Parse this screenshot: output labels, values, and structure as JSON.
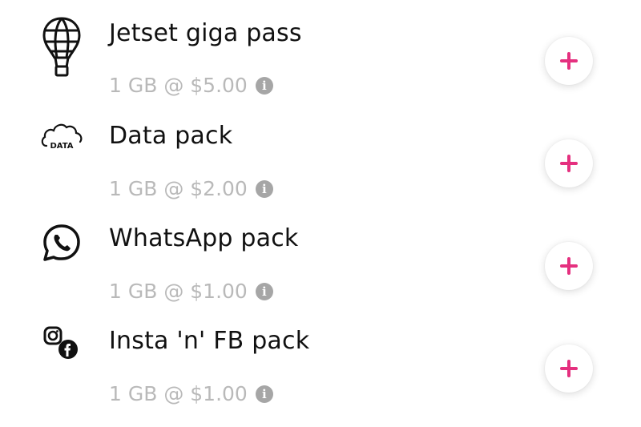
{
  "accent_color": "#e5307f",
  "packs": [
    {
      "title": "Jetset giga pass",
      "price": "1 GB @ $5.00",
      "icon": "hot-air-balloon-icon"
    },
    {
      "title": "Data pack",
      "price": "1 GB @ $2.00",
      "icon": "data-cloud-icon",
      "icon_text": "DATA"
    },
    {
      "title": "WhatsApp pack",
      "price": "1 GB @ $1.00",
      "icon": "whatsapp-icon"
    },
    {
      "title": "Insta 'n' FB pack",
      "price": "1 GB @ $1.00",
      "icon": "instagram-facebook-icon"
    }
  ],
  "info_glyph": "i"
}
